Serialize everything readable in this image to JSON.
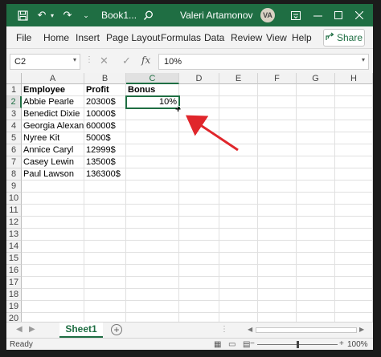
{
  "titlebar": {
    "title": "Book1...",
    "user": "Valeri Artamonov",
    "avatar_initials": "VA",
    "icons": [
      "save-icon",
      "undo-icon",
      "redo-icon",
      "customize-icon",
      "search-icon",
      "ribbon-display-icon",
      "minimize-icon",
      "maximize-icon",
      "close-icon"
    ]
  },
  "ribbon": {
    "tabs": [
      "File",
      "Home",
      "Insert",
      "Page Layout",
      "Formulas",
      "Data",
      "Review",
      "View",
      "Help"
    ],
    "share_label": "Share"
  },
  "formula_bar": {
    "name_box": "C2",
    "formula": "10%"
  },
  "grid": {
    "columns": [
      "A",
      "B",
      "C",
      "D",
      "E",
      "F",
      "G",
      "H"
    ],
    "selected_column": "C",
    "rows": [
      "1",
      "2",
      "3",
      "4",
      "5",
      "6",
      "7",
      "8",
      "9",
      "10",
      "11",
      "12",
      "13",
      "14",
      "15",
      "16",
      "17",
      "18",
      "19",
      "20"
    ],
    "selected_row": "2",
    "headers": {
      "a": "Employee",
      "b": "Profit",
      "c": "Bonus"
    },
    "data": [
      {
        "name": "Abbie Pearle",
        "profit": "20300$",
        "bonus": "10%"
      },
      {
        "name": "Benedict Dixie",
        "profit": "10000$",
        "bonus": ""
      },
      {
        "name": "Georgia Alexander",
        "profit": "60000$",
        "bonus": ""
      },
      {
        "name": "Nyree Kit",
        "profit": "5000$",
        "bonus": ""
      },
      {
        "name": "Annice Caryl",
        "profit": "12999$",
        "bonus": ""
      },
      {
        "name": "Casey Lewin",
        "profit": "13500$",
        "bonus": ""
      },
      {
        "name": "Paul Lawson",
        "profit": "136300$",
        "bonus": ""
      }
    ],
    "annotation_color": "#e0262b"
  },
  "sheets": {
    "tabs": [
      "Sheet1"
    ],
    "active": "Sheet1"
  },
  "status": {
    "text": "Ready",
    "zoom": "100%"
  },
  "colors": {
    "accent": "#1f6e43"
  }
}
